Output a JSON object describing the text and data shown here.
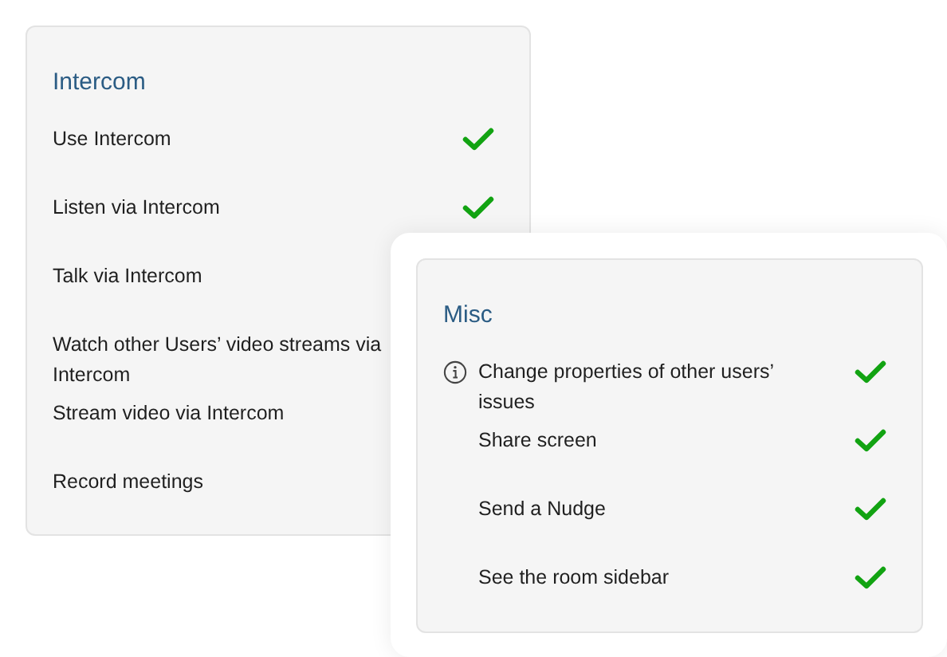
{
  "sections": [
    {
      "title": "Intercom",
      "items": [
        {
          "label": "Use Intercom",
          "checked": true
        },
        {
          "label": "Listen via Intercom",
          "checked": true
        },
        {
          "label": "Talk via Intercom"
        },
        {
          "label": "Watch other Users’ video streams via Intercom"
        },
        {
          "label": "Stream video via Intercom"
        },
        {
          "label": "Record meetings"
        }
      ]
    },
    {
      "title": "Misc",
      "items": [
        {
          "label": "Change properties of other users’ issues",
          "checked": true,
          "info": true
        },
        {
          "label": "Share screen",
          "checked": true
        },
        {
          "label": "Send a Nudge",
          "checked": true
        },
        {
          "label": "See the room sidebar",
          "checked": true
        }
      ]
    }
  ]
}
